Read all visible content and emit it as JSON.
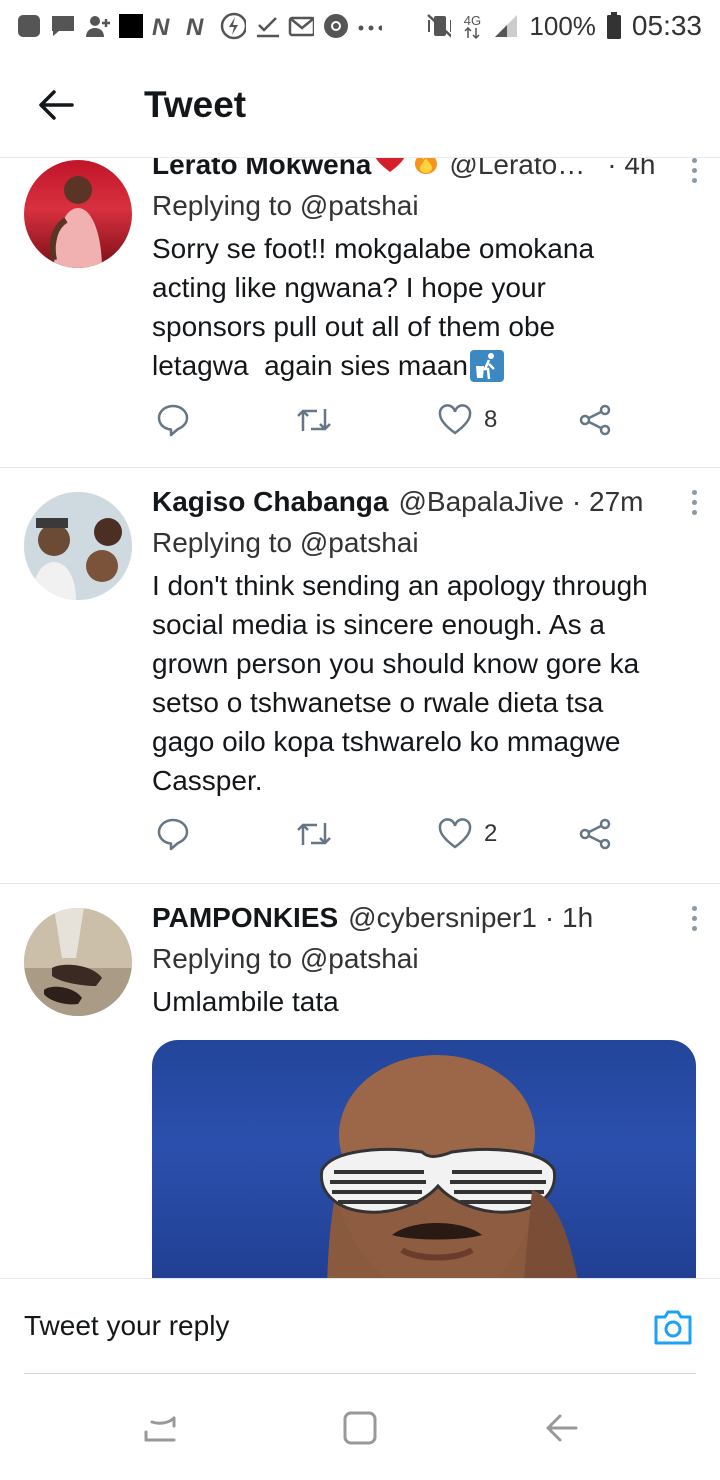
{
  "status_bar": {
    "battery": "100%",
    "time": "05:33",
    "network": "4G",
    "icons": [
      "app-square-icon",
      "message-icon",
      "add-contact-icon",
      "black-square-icon",
      "nn-icon",
      "nn-icon",
      "lightning-icon",
      "download-check-icon",
      "mail-icon",
      "chrome-icon",
      "more-dots-icon",
      "vibrate-mute-icon",
      "4g-icon",
      "signal-icon",
      "battery-icon"
    ]
  },
  "header": {
    "title": "Tweet"
  },
  "tweets": [
    {
      "name": "Lerato Mokwena",
      "emojis": [
        "heart-emoji",
        "fire-emoji"
      ],
      "handle": "@Lerato…",
      "time": "· 4h",
      "replying": "Replying to @patshai",
      "lines": [
        "Sorry se foot!! mokgalabe omokana",
        "acting like ngwana? I hope your",
        "sponsors pull out all of them obe",
        "letagwa  again sies maan"
      ],
      "trailing_emoji": "litter-bin-emoji",
      "likes": "8"
    },
    {
      "name": "Kagiso Chabanga",
      "handle": "@BapalaJive",
      "time": "· 27m",
      "replying": "Replying to @patshai",
      "lines": [
        "I don't think sending an apology through",
        "social media is sincere enough. As a",
        "grown person you should know gore ka",
        "setso o tshwanetse o rwale dieta tsa",
        "gago oilo kopa tshwarelo ko mmagwe",
        "Cassper."
      ],
      "likes": "2"
    },
    {
      "name": "PAMPONKIES",
      "handle": "@cybersniper1",
      "time": "· 1h",
      "replying": "Replying to @patshai",
      "lines": [
        "Umlambile tata"
      ]
    }
  ],
  "reply_bar": {
    "placeholder": "Tweet your reply"
  },
  "colors": {
    "accent": "#1da1f2",
    "text": "#14171a",
    "muted": "#333333",
    "divider": "#e1e8ed"
  }
}
